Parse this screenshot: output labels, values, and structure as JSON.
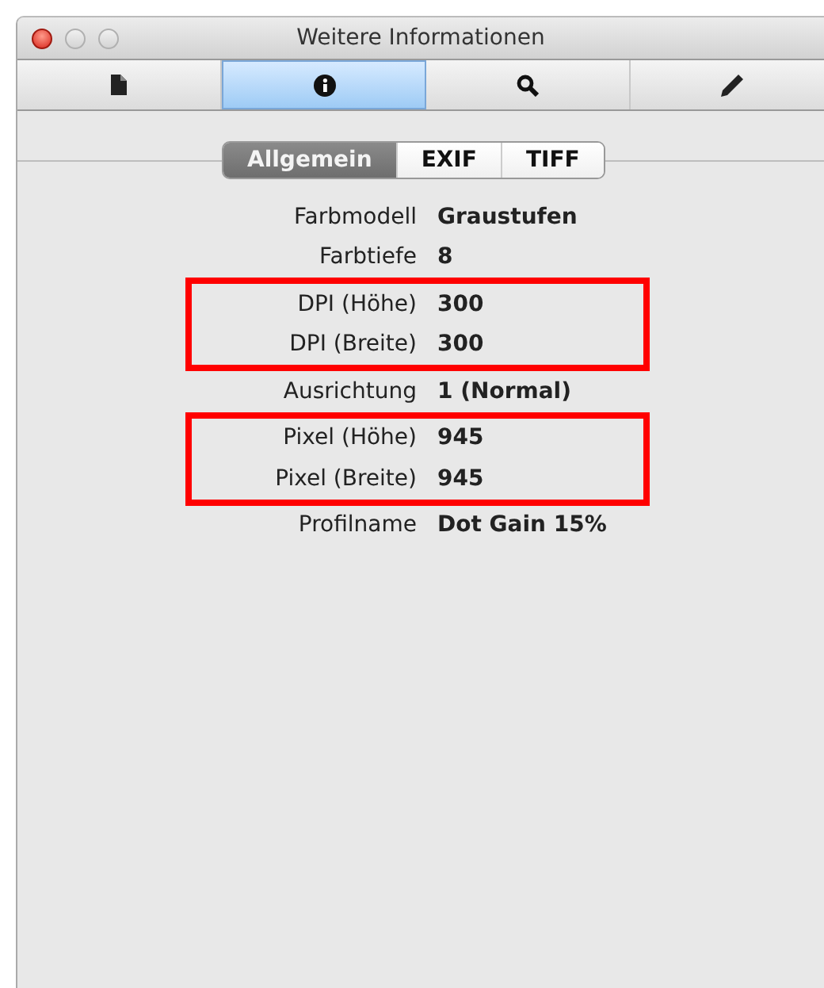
{
  "window": {
    "title": "Weitere Informationen"
  },
  "toolbar": [
    {
      "kind": "document",
      "selected": false
    },
    {
      "kind": "info",
      "selected": true
    },
    {
      "kind": "search",
      "selected": false
    },
    {
      "kind": "pencil",
      "selected": false
    }
  ],
  "tabs": [
    {
      "label": "Allgemein",
      "selected": true
    },
    {
      "label": "EXIF",
      "selected": false
    },
    {
      "label": "TIFF",
      "selected": false
    }
  ],
  "groups": [
    {
      "highlighted": false,
      "rows": [
        {
          "label": "Farbmodell",
          "value": "Graustufen"
        },
        {
          "label": "Farbtiefe",
          "value": "8"
        }
      ]
    },
    {
      "highlighted": true,
      "rows": [
        {
          "label": "DPI (Höhe)",
          "value": "300"
        },
        {
          "label": "DPI (Breite)",
          "value": "300"
        }
      ]
    },
    {
      "highlighted": false,
      "rows": [
        {
          "label": "Ausrichtung",
          "value": "1 (Normal)"
        }
      ]
    },
    {
      "highlighted": true,
      "rows": [
        {
          "label": "Pixel (Höhe)",
          "value": "945"
        },
        {
          "label": "Pixel (Breite)",
          "value": "945"
        }
      ]
    },
    {
      "highlighted": false,
      "rows": [
        {
          "label": "Profilname",
          "value": "Dot Gain 15%"
        }
      ]
    }
  ]
}
